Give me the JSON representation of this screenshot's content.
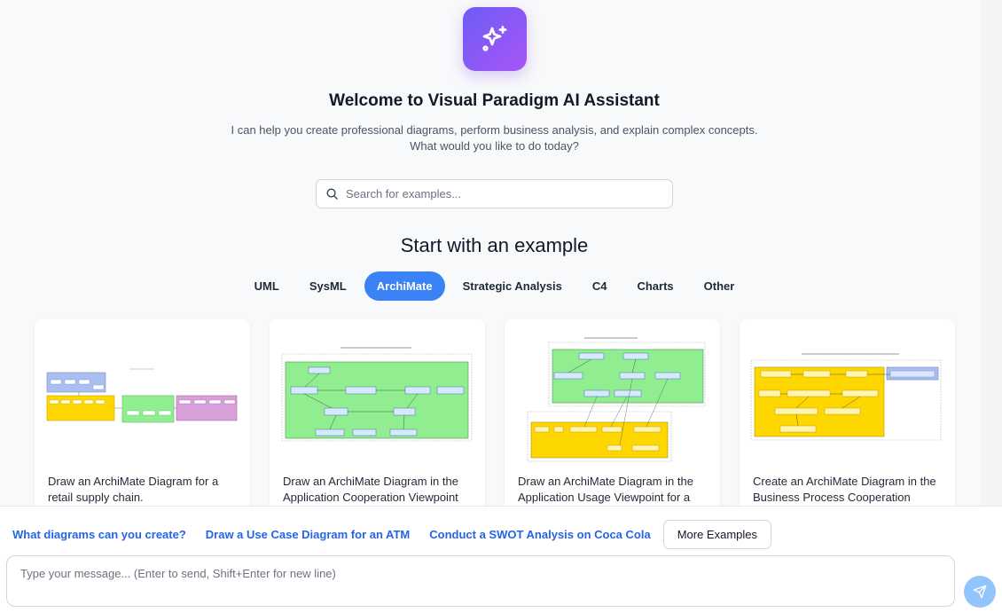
{
  "hero": {
    "title": "Welcome to Visual Paradigm AI Assistant",
    "subtitle": "I can help you create professional diagrams, perform business analysis, and explain complex concepts. What would you like to do today?",
    "logo_icon": "sparkles-icon",
    "logo_gradient": [
      "#6d5cf6",
      "#a855f7"
    ]
  },
  "search": {
    "placeholder": "Search for examples...",
    "icon": "search-icon"
  },
  "examples": {
    "heading": "Start with an example",
    "tabs": [
      {
        "label": "UML",
        "active": false
      },
      {
        "label": "SysML",
        "active": false
      },
      {
        "label": "ArchiMate",
        "active": true
      },
      {
        "label": "Strategic Analysis",
        "active": false
      },
      {
        "label": "C4",
        "active": false
      },
      {
        "label": "Charts",
        "active": false
      },
      {
        "label": "Other",
        "active": false
      }
    ],
    "cards": [
      {
        "description": "Draw an ArchiMate Diagram for a retail supply chain."
      },
      {
        "description": "Draw an ArchiMate Diagram in the Application Cooperation Viewpoint for"
      },
      {
        "description": "Draw an ArchiMate Diagram in the Application Usage Viewpoint for a"
      },
      {
        "description": "Create an ArchiMate Diagram in the Business Process Cooperation"
      }
    ]
  },
  "suggestions": [
    "What diagrams can you create?",
    "Draw a Use Case Diagram for an ATM",
    "Conduct a SWOT Analysis on Coca Cola"
  ],
  "more_examples_label": "More Examples",
  "composer": {
    "placeholder": "Type your message... (Enter to send, Shift+Enter for new line)",
    "send_icon": "send-icon"
  },
  "colors": {
    "accent": "#3b82f6",
    "link": "#2563eb",
    "send_button": "#93c5fd",
    "application_layer": "#90ee90",
    "business_layer": "#ffd700",
    "technology_layer": "#d8a0d8",
    "strategy_layer": "#a8bff0"
  }
}
